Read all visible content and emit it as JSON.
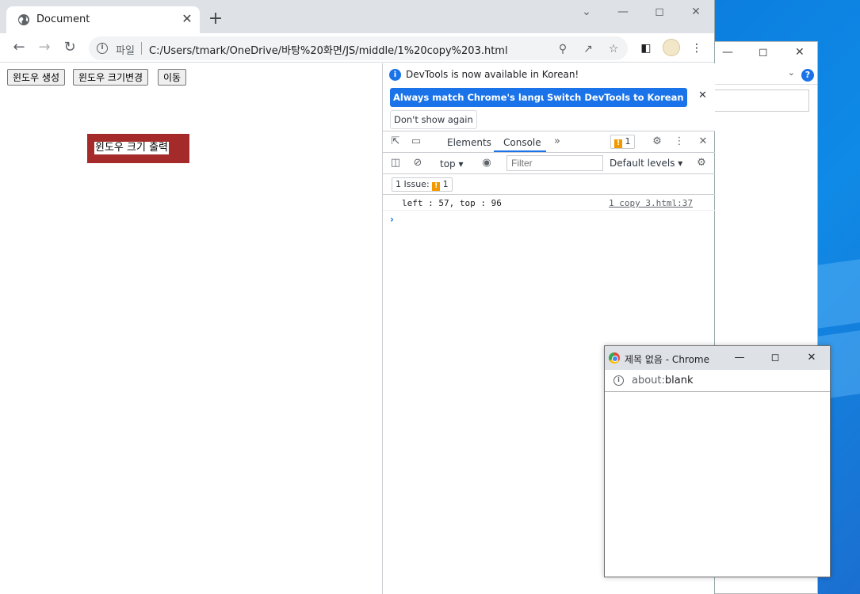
{
  "browser": {
    "tab_title": "Document",
    "url_scheme": "파일",
    "url": "C:/Users/tmark/OneDrive/바탕%20화면/JS/middle/1%20copy%203.html"
  },
  "page": {
    "buttons": [
      "윈도우 생성",
      "윈도우 크기변경",
      "이동"
    ],
    "output_box": "윈도우 크기 출력"
  },
  "devtools": {
    "infobar_message": "DevTools is now available in Korean!",
    "btn_match_language": "Always match Chrome's language",
    "btn_switch_korean": "Switch DevTools to Korean",
    "btn_dont_show": "Don't show again",
    "tabs": {
      "elements": "Elements",
      "console": "Console"
    },
    "issues_count": "1",
    "context": "top",
    "filter_placeholder": "Filter",
    "levels": "Default levels",
    "issues_label": "1 Issue:",
    "issues_badge_count": "1",
    "log_message": "left : 57, top : 96",
    "log_source": "1 copy 3.html:37",
    "prompt": "›"
  },
  "popup": {
    "title": "제목 없음 - Chrome",
    "url_scheme": "about:",
    "url_path": "blank"
  },
  "colors": {
    "output_box_bg": "#a52a2a",
    "accent": "#1a73e8",
    "issue_flag": "#f29900"
  }
}
